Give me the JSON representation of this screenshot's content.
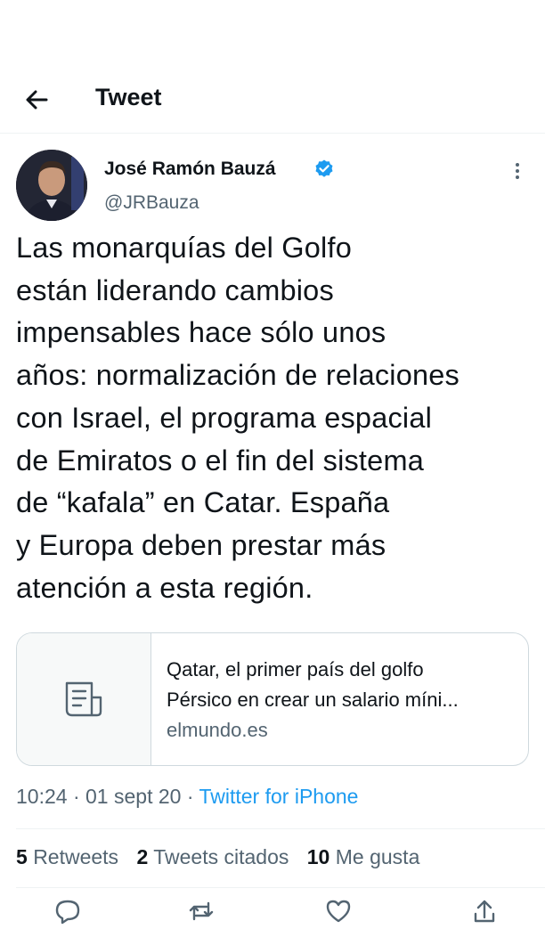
{
  "header": {
    "title": "Tweet",
    "back_icon": "arrow-left-icon"
  },
  "author": {
    "name": "José Ramón Bauzá",
    "handle": "@JRBauza",
    "verified": true,
    "verified_color": "#1d9bf0"
  },
  "tweet": {
    "text": "Las monarquías del Golfo\nestán liderando cambios\nimpensables hace sólo unos\naños: normalización de relaciones\ncon Israel, el programa espacial\nde Emiratos o el fin del sistema\nde “kafala” en Catar. España\ny Europa deben prestar más\natención a esta región."
  },
  "link_card": {
    "title_line_1": "Qatar, el primer país del golfo",
    "title_line_2": "Pérsico en crear un salario míni...",
    "domain": "elmundo.es",
    "icon": "article-icon"
  },
  "meta": {
    "time": "10:24",
    "separator": "·",
    "date": "01 sept 20",
    "source": "Twitter for iPhone"
  },
  "stats": {
    "retweets_count": "5",
    "retweets_label": "Retweets",
    "quotes_count": "2",
    "quotes_label": "Tweets citados",
    "likes_count": "10",
    "likes_label": "Me gusta"
  },
  "colors": {
    "accent": "#1d9bf0",
    "secondary_text": "#536471",
    "primary_text": "#0f1419",
    "border": "#cfd9de"
  }
}
